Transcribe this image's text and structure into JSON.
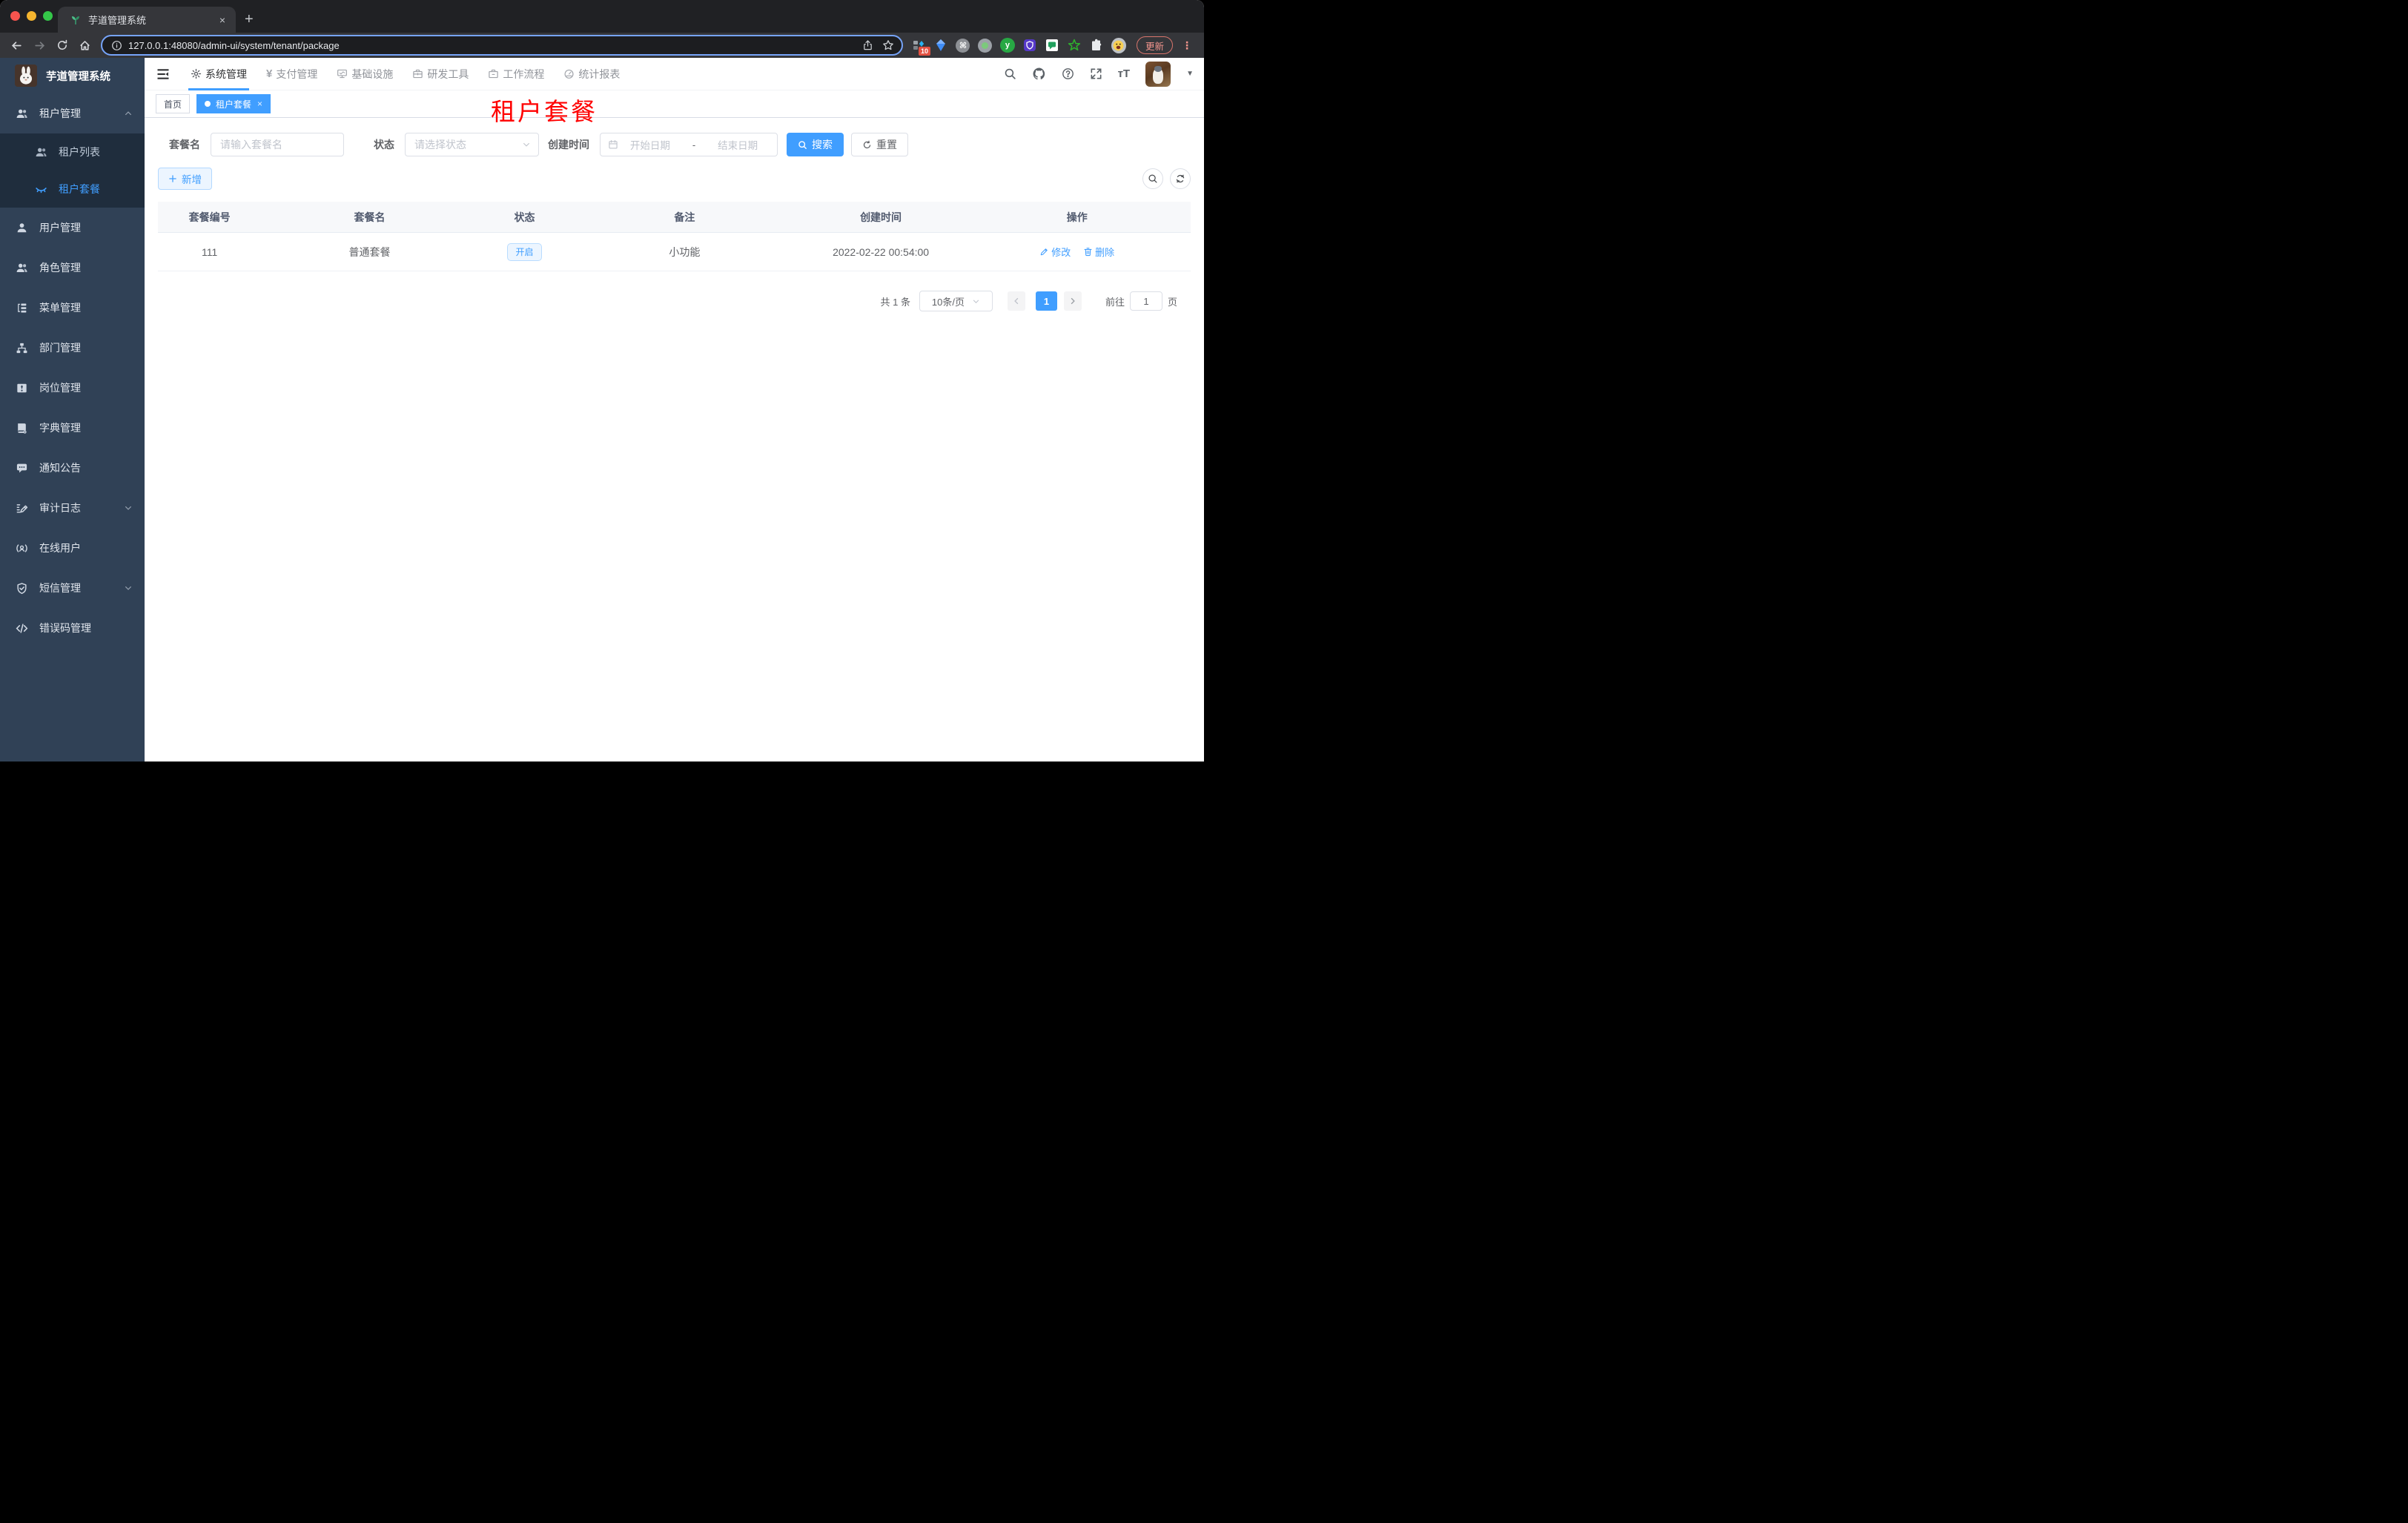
{
  "browser": {
    "tab_title": "芋道管理系统",
    "tab_close": "×",
    "new_tab": "+",
    "url": "127.0.0.1:48080/admin-ui/system/tenant/package",
    "extension_badge_count": "10",
    "update_button": "更新",
    "kebab_menu": "⋮"
  },
  "header": {
    "logo_title": "芋道管理系统",
    "menu": [
      {
        "label": "系统管理",
        "icon": "gear-icon",
        "active": true
      },
      {
        "label": "支付管理",
        "icon": "yen-icon",
        "active": false
      },
      {
        "label": "基础设施",
        "icon": "monitor-icon",
        "active": false
      },
      {
        "label": "研发工具",
        "icon": "toolbox-icon",
        "active": false
      },
      {
        "label": "工作流程",
        "icon": "workflow-icon",
        "active": false
      },
      {
        "label": "统计报表",
        "icon": "dashboard-icon",
        "active": false
      }
    ]
  },
  "sidebar": {
    "groups": [
      {
        "label": "租户管理",
        "icon": "users-icon",
        "expanded": true,
        "children": [
          {
            "label": "租户列表",
            "icon": "users-icon",
            "active": false
          },
          {
            "label": "租户套餐",
            "icon": "eye-closed-icon",
            "active": true
          }
        ]
      },
      {
        "label": "用户管理",
        "icon": "user-icon"
      },
      {
        "label": "角色管理",
        "icon": "users-icon"
      },
      {
        "label": "菜单管理",
        "icon": "tree-icon"
      },
      {
        "label": "部门管理",
        "icon": "org-chart-icon"
      },
      {
        "label": "岗位管理",
        "icon": "badge-icon"
      },
      {
        "label": "字典管理",
        "icon": "dictionary-icon"
      },
      {
        "label": "通知公告",
        "icon": "message-icon"
      },
      {
        "label": "审计日志",
        "icon": "log-icon",
        "collapsible": true
      },
      {
        "label": "在线用户",
        "icon": "online-user-icon"
      },
      {
        "label": "短信管理",
        "icon": "shield-icon",
        "collapsible": true
      },
      {
        "label": "错误码管理",
        "icon": "code-icon"
      }
    ]
  },
  "tags_view": {
    "tags": [
      {
        "label": "首页",
        "active": false
      },
      {
        "label": "租户套餐",
        "active": true
      }
    ]
  },
  "overlay_title": {
    "text": "租户套餐",
    "color": "#ff0000"
  },
  "filter_form": {
    "name_label": "套餐名",
    "name_placeholder": "请输入套餐名",
    "status_label": "状态",
    "status_placeholder": "请选择状态",
    "time_label": "创建时间",
    "start_placeholder": "开始日期",
    "range_separator": "-",
    "end_placeholder": "结束日期",
    "search_button": "搜索",
    "reset_button": "重置"
  },
  "toolbar": {
    "add_button": "新增"
  },
  "table": {
    "headers": [
      "套餐编号",
      "套餐名",
      "状态",
      "备注",
      "创建时间",
      "操作"
    ],
    "rows": [
      {
        "id": "111",
        "name": "普通套餐",
        "status": "开启",
        "remark": "小功能",
        "create_time": "2022-02-22 00:54:00",
        "actions": {
          "edit": "修改",
          "delete": "删除"
        }
      }
    ]
  },
  "pagination": {
    "total_text": "共 1 条",
    "page_size": "10条/页",
    "current_page": "1",
    "prev": "‹",
    "next": "›",
    "goto_label": "前往",
    "goto_value": "1",
    "page_unit": "页"
  },
  "colors": {
    "accent": "#409eff",
    "sidebar_bg": "#304156",
    "submenu_bg": "#1f2d3d",
    "status_tag_bg": "#ecf5ff",
    "status_tag_border": "#b9dcff",
    "annotation_red": "#ff0000",
    "active_menu_underline": "#409eff"
  }
}
